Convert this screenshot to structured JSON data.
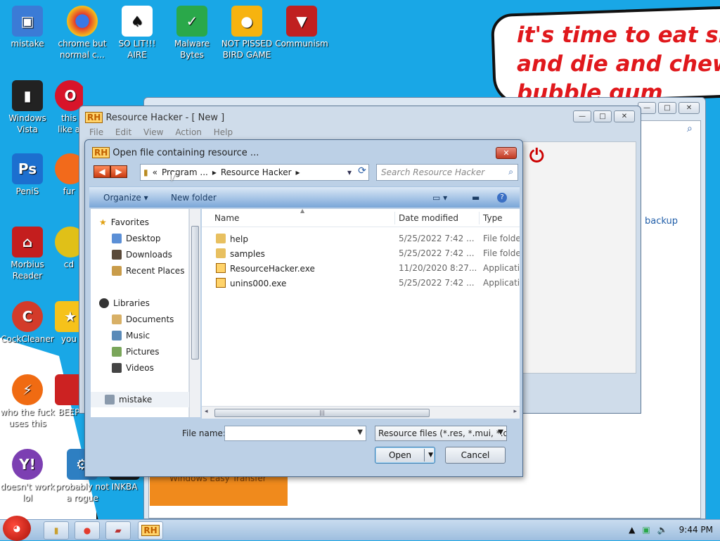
{
  "desktop": {
    "cloud_text": [
      "it's time to eat shit",
      "and die and chew",
      "bubble gum"
    ],
    "icons": [
      {
        "label": "mistake",
        "color": "#3b7bd6"
      },
      {
        "label": "chrome but normal c...",
        "color": "#e33b2d"
      },
      {
        "label": "SO LIT!!! AIRE",
        "color": "#ffffff"
      },
      {
        "label": "Malware Bytes",
        "color": "#2aa84a"
      },
      {
        "label": "NOT PISSED BIRD GAME",
        "color": "#f7b30f"
      },
      {
        "label": "Communism",
        "color": "#c02020"
      },
      {
        "label": "Windows Vista",
        "color": "#222222"
      },
      {
        "label": "this like a",
        "color": "#d8142a"
      },
      {
        "label": "PeniS",
        "color": "#1c6fcf"
      },
      {
        "label": "fur",
        "color": "#f26a1b"
      },
      {
        "label": "Morbius Reader",
        "color": "#c41e1e"
      },
      {
        "label": "cd",
        "color": "#e0c018"
      },
      {
        "label": "CockCleaner",
        "color": "#d33b2a"
      },
      {
        "label": "you",
        "color": "#f6c21a"
      },
      {
        "label": "who the fuck uses this",
        "color": "#f06b12"
      },
      {
        "label": "BEEP",
        "color": "#cc2222"
      },
      {
        "label": "doesn't work lol",
        "color": "#7c3fb2"
      },
      {
        "label": "probably not a rogue",
        "color": "#2e7fc2"
      },
      {
        "label": "INKBA",
        "color": "#1a1a1a"
      }
    ]
  },
  "bg_window": {
    "backup_link": "backup",
    "orange_panel_text": "Windows Easy Transfer"
  },
  "rh_window": {
    "title": "Resource Hacker - [ New ]",
    "menu": [
      "File",
      "Edit",
      "View",
      "Action",
      "Help"
    ]
  },
  "dialog": {
    "title": "Open file containing resource ...",
    "address": {
      "prefix": "«",
      "crumbs": [
        "Program ...",
        "Resource Hacker"
      ]
    },
    "search_placeholder": "Search Resource Hacker",
    "toolbar": {
      "organize": "Organize ▾",
      "new_folder": "New folder"
    },
    "nav": {
      "favorites": "Favorites",
      "favorites_items": [
        "Desktop",
        "Downloads",
        "Recent Places"
      ],
      "libraries": "Libraries",
      "library_items": [
        "Documents",
        "Music",
        "Pictures",
        "Videos"
      ],
      "computer": "mistake"
    },
    "columns": {
      "name": "Name",
      "date": "Date modified",
      "type": "Type"
    },
    "files": [
      {
        "name": "help",
        "date": "5/25/2022 7:42 ...",
        "type": "File folde",
        "kind": "folder"
      },
      {
        "name": "samples",
        "date": "5/25/2022 7:42 ...",
        "type": "File folde",
        "kind": "folder"
      },
      {
        "name": "ResourceHacker.exe",
        "date": "11/20/2020 8:27...",
        "type": "Applicati",
        "kind": "exe"
      },
      {
        "name": "unins000.exe",
        "date": "5/25/2022 7:42 ...",
        "type": "Applicati",
        "kind": "exe"
      }
    ],
    "file_name_label": "File name:",
    "file_name_value": "",
    "file_type": "Resource files (*.res, *.mui, *.dll",
    "open_button": "Open",
    "cancel_button": "Cancel"
  },
  "taskbar": {
    "clock": "9:44 PM",
    "app_rh": "RH"
  },
  "colors": {
    "desktop": "#19a7e6",
    "accent": "#1f5da8",
    "cloud_text": "#e0181c"
  }
}
